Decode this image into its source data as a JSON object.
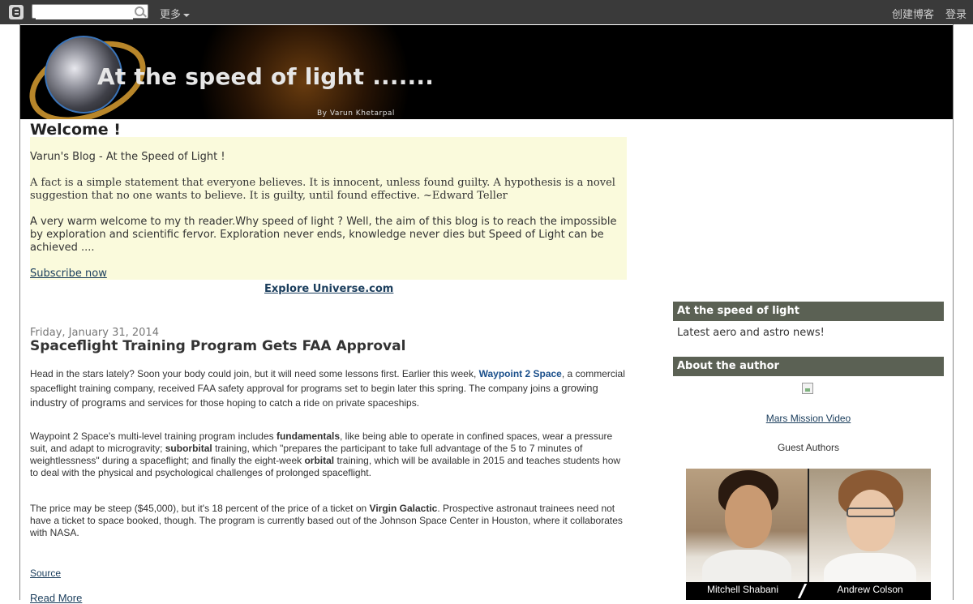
{
  "navbar": {
    "logo_icon": "blogger-logo-icon",
    "search_placeholder": "",
    "more_label": "更多",
    "create_blog_label": "创建博客",
    "login_label": "登录"
  },
  "header": {
    "title": "At the speed of light .......",
    "byline": "By Varun Khetarpal"
  },
  "welcome": {
    "heading": "Welcome !",
    "blog_line": "Varun's Blog - At the Speed of Light !",
    "quote": "A fact is a simple statement that everyone believes. It is innocent, unless found guilty. A hypothesis is a novel suggestion that no one wants to believe. It is guilty, until found effective. ~Edward Teller",
    "welcome_text": "A very warm welcome to my th reader.Why speed of light ? Well, the aim of this blog is to reach the impossible by exploration and scientific fervor. Exploration never ends, knowledge never dies but Speed of Light can be achieved ....",
    "subscribe_label": "Subscribe now",
    "explore_label": "Explore Universe.com"
  },
  "post": {
    "date": "Friday, January 31, 2014",
    "title": "Spaceflight Training Program Gets FAA Approval",
    "p1_a": "Head in the stars lately? Soon your body could join, but it will need some lessons first. Earlier this week, ",
    "p1_link": "Waypoint 2 Space",
    "p1_b": ", a commercial spaceflight training company, received FAA safety approval for programs set to begin later this spring. The company joins a ",
    "p1_c": "growing industry of programs",
    "p1_d": " and services for those hoping to catch a ride on private spaceships.",
    "p2_a": "Waypoint 2 Space's multi-level training program includes ",
    "p2_b": "fundamentals",
    "p2_c": ", like being able to operate in confined spaces, wear a pressure suit, and adapt to microgravity; ",
    "p2_d": "suborbital",
    "p2_e": " training, which \"prepares the participant to take full advantage of the 5 to 7 minutes of weightlessness\" during a spaceflight; and finally the eight-week ",
    "p2_f": "orbital",
    "p2_g": " training, which will be available in 2015 and teaches students how to deal with the physical and psychological challenges of prolonged spaceflight.",
    "p3_a": "The price may be steep ($45,000), but it's 18 percent of the price of a ticket on ",
    "p3_b": "Virgin Galactic",
    "p3_c": ". Prospective astronaut trainees need not have a ticket to space booked, though. The program is currently based out of the Johnson Space Center in Houston, where it collaborates with NASA.",
    "source_label": "Source",
    "read_more_label": "Read More"
  },
  "sidebar": {
    "section1_title": "At the speed of light",
    "section1_text": "Latest aero and astro news!",
    "section2_title": "About the author",
    "mars_link": "Mars Mission Video",
    "guest_label": "Guest Authors",
    "author1": "Mitchell Shabani",
    "author2": "Andrew Colson"
  },
  "colors": {
    "navbar_bg": "#3a3a3a",
    "welcome_bg": "#fafadc",
    "sidebar_header_bg": "#5b6154",
    "link": "#1a3d5c"
  }
}
